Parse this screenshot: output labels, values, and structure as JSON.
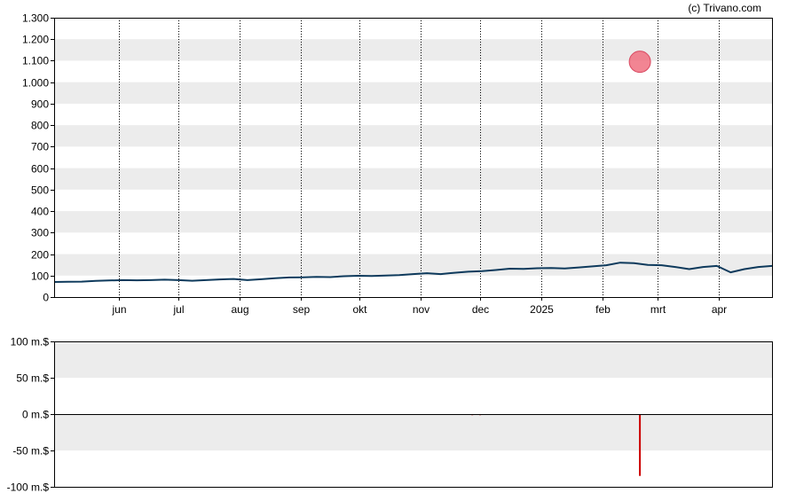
{
  "credit": "(c) Trivano.com",
  "colors": {
    "band": "#ececec",
    "price_line": "#0e3a5c",
    "marker_fill": "#f07080",
    "marker_stroke": "#d84860",
    "volume_bar": "#cc0000",
    "axis": "#000000"
  },
  "chart_data": [
    {
      "type": "line",
      "title": "",
      "xlabel": "",
      "ylabel": "",
      "ylim": [
        0,
        1300
      ],
      "y_ticks": [
        {
          "value": 0,
          "label": "0"
        },
        {
          "value": 100,
          "label": "100"
        },
        {
          "value": 200,
          "label": "200"
        },
        {
          "value": 300,
          "label": "300"
        },
        {
          "value": 400,
          "label": "400"
        },
        {
          "value": 500,
          "label": "500"
        },
        {
          "value": 600,
          "label": "600"
        },
        {
          "value": 700,
          "label": "700"
        },
        {
          "value": 800,
          "label": "800"
        },
        {
          "value": 900,
          "label": "900"
        },
        {
          "value": 1000,
          "label": "1.000"
        },
        {
          "value": 1100,
          "label": "1.100"
        },
        {
          "value": 1200,
          "label": "1.200"
        },
        {
          "value": 1300,
          "label": "1.300"
        }
      ],
      "x_range": [
        "2024-04-29",
        "2025-04-28"
      ],
      "x_ticks": [
        {
          "date": "2024-06-01",
          "label": "jun"
        },
        {
          "date": "2024-07-01",
          "label": "jul"
        },
        {
          "date": "2024-08-01",
          "label": "aug"
        },
        {
          "date": "2024-09-01",
          "label": "sep"
        },
        {
          "date": "2024-10-01",
          "label": "okt"
        },
        {
          "date": "2024-11-01",
          "label": "nov"
        },
        {
          "date": "2024-12-01",
          "label": "dec"
        },
        {
          "date": "2025-01-01",
          "label": "2025"
        },
        {
          "date": "2025-02-01",
          "label": "feb"
        },
        {
          "date": "2025-03-01",
          "label": "mrt"
        },
        {
          "date": "2025-04-01",
          "label": "apr"
        }
      ],
      "grid": "vertical dotted lines at month ticks, alternating horizontal bands",
      "series": [
        {
          "points": [
            [
              "2024-04-29",
              70
            ],
            [
              "2024-05-06",
              71
            ],
            [
              "2024-05-13",
              72
            ],
            [
              "2024-05-20",
              75
            ],
            [
              "2024-05-27",
              77
            ],
            [
              "2024-06-03",
              79
            ],
            [
              "2024-06-10",
              78
            ],
            [
              "2024-06-17",
              79
            ],
            [
              "2024-06-24",
              81
            ],
            [
              "2024-07-01",
              79
            ],
            [
              "2024-07-08",
              76
            ],
            [
              "2024-07-15",
              79
            ],
            [
              "2024-07-22",
              82
            ],
            [
              "2024-07-29",
              84
            ],
            [
              "2024-08-05",
              79
            ],
            [
              "2024-08-12",
              83
            ],
            [
              "2024-08-19",
              88
            ],
            [
              "2024-08-26",
              91
            ],
            [
              "2024-09-02",
              92
            ],
            [
              "2024-09-09",
              94
            ],
            [
              "2024-09-16",
              93
            ],
            [
              "2024-09-23",
              97
            ],
            [
              "2024-09-30",
              99
            ],
            [
              "2024-10-07",
              98
            ],
            [
              "2024-10-14",
              100
            ],
            [
              "2024-10-21",
              102
            ],
            [
              "2024-10-28",
              107
            ],
            [
              "2024-11-04",
              111
            ],
            [
              "2024-11-11",
              107
            ],
            [
              "2024-11-18",
              113
            ],
            [
              "2024-11-25",
              118
            ],
            [
              "2024-12-02",
              121
            ],
            [
              "2024-12-09",
              126
            ],
            [
              "2024-12-16",
              132
            ],
            [
              "2024-12-23",
              131
            ],
            [
              "2024-12-30",
              134
            ],
            [
              "2025-01-06",
              135
            ],
            [
              "2025-01-13",
              133
            ],
            [
              "2025-01-20",
              138
            ],
            [
              "2025-01-27",
              143
            ],
            [
              "2025-02-03",
              148
            ],
            [
              "2025-02-10",
              160
            ],
            [
              "2025-02-17",
              158
            ],
            [
              "2025-02-24",
              150
            ],
            [
              "2025-03-03",
              148
            ],
            [
              "2025-03-10",
              140
            ],
            [
              "2025-03-17",
              130
            ],
            [
              "2025-03-24",
              140
            ],
            [
              "2025-03-31",
              145
            ],
            [
              "2025-04-07",
              115
            ],
            [
              "2025-04-14",
              130
            ],
            [
              "2025-04-21",
              140
            ],
            [
              "2025-04-28",
              145
            ]
          ]
        }
      ],
      "annotations": [
        {
          "type": "marker",
          "date": "2025-02-20",
          "value": 1095
        }
      ]
    },
    {
      "type": "bar",
      "title": "",
      "xlabel": "",
      "ylabel": "",
      "ylim": [
        -100,
        100
      ],
      "y_ticks": [
        {
          "value": 100,
          "label": "100 m.$"
        },
        {
          "value": 50,
          "label": "50 m.$"
        },
        {
          "value": 0,
          "label": "0 m.$"
        },
        {
          "value": -50,
          "label": "-50 m.$"
        },
        {
          "value": -100,
          "label": "-100 m.$"
        }
      ],
      "x_range": [
        "2024-04-29",
        "2025-04-28"
      ],
      "bars": [
        {
          "date": "2024-11-27",
          "value": -1.5
        },
        {
          "date": "2024-12-01",
          "value": -1.5
        },
        {
          "date": "2024-12-12",
          "value": -1
        },
        {
          "date": "2025-02-20",
          "value": -85
        },
        {
          "date": "2025-03-02",
          "value": -1
        }
      ]
    }
  ]
}
